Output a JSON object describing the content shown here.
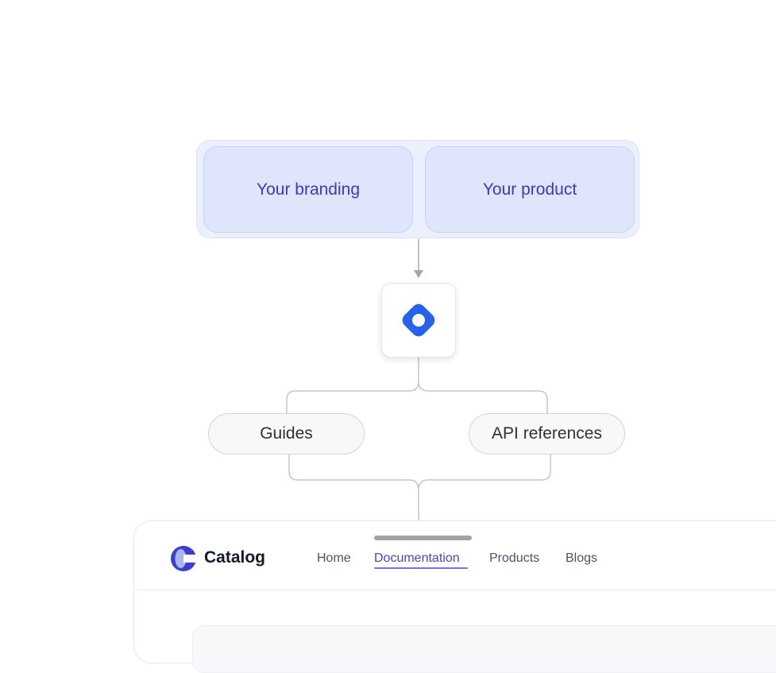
{
  "diagram": {
    "inputs": [
      {
        "label": "Your branding"
      },
      {
        "label": "Your product"
      }
    ],
    "hub": {
      "icon": "diamond-ring-logo-icon",
      "color": "#2563eb"
    },
    "outputs": [
      {
        "label": "Guides"
      },
      {
        "label": "API references"
      }
    ]
  },
  "site": {
    "brand": {
      "name": "Catalog",
      "logo_icon": "c-logo-icon",
      "logo_colors": [
        "#3b3fd0",
        "#a9b6f5"
      ]
    },
    "nav": [
      {
        "label": "Home",
        "active": false
      },
      {
        "label": "Documentation",
        "active": true
      },
      {
        "label": "Products",
        "active": false
      },
      {
        "label": "Blogs",
        "active": false
      }
    ]
  },
  "colors": {
    "accent": "#4b3fcc",
    "input_text": "#3f37c4",
    "input_fill": "#dfe6fc",
    "hub_blue": "#2563eb",
    "connector": "#c3c5ca"
  }
}
